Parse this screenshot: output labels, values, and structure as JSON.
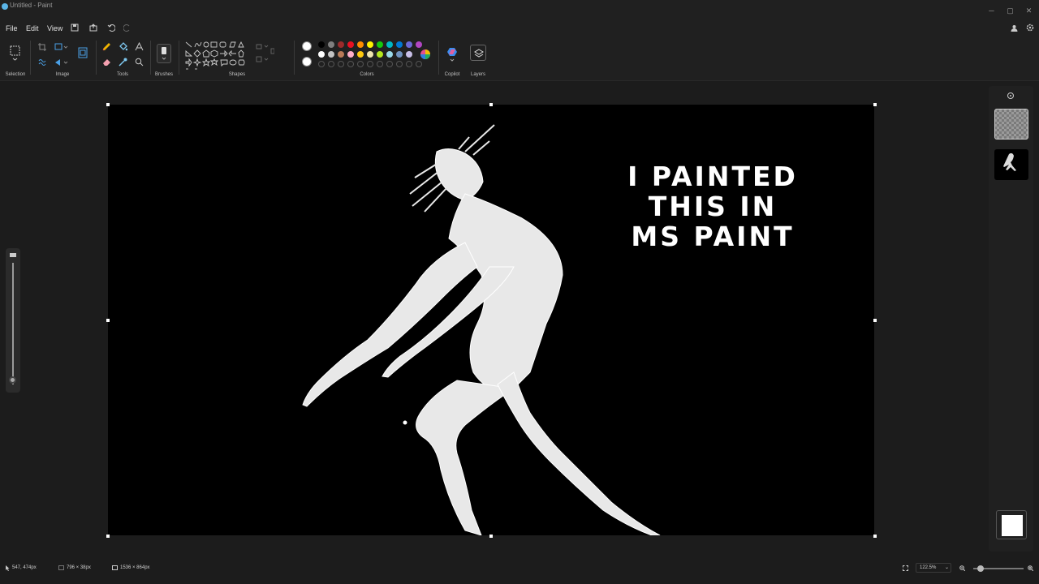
{
  "window": {
    "title": "Untitled - Paint",
    "minimize": "─",
    "maximize": "▢",
    "close": "✕"
  },
  "menu": {
    "file": "File",
    "edit": "Edit",
    "view": "View"
  },
  "ribbon": {
    "groups": {
      "selection": "Selection",
      "image": "Image",
      "tools": "Tools",
      "brushes": "Brushes",
      "shapes": "Shapes",
      "colors": "Colors",
      "copilot": "Copilot",
      "layers": "Layers"
    },
    "palette_row1": [
      "#000000",
      "#7f7f7f",
      "#9b2b2b",
      "#e81123",
      "#ff8c00",
      "#fff100",
      "#16c60c",
      "#00b7c3",
      "#0078d4",
      "#6b69d6",
      "#b146c2"
    ],
    "palette_row2": [
      "#ffffff",
      "#c3c3c3",
      "#b97a57",
      "#ffaec9",
      "#ffc90e",
      "#efe4b0",
      "#b5e61d",
      "#99d9ea",
      "#7092be",
      "#c8bfe7"
    ],
    "primary_color": "#ffffff",
    "secondary_color": "#ffffff"
  },
  "canvas": {
    "text_lines": "I PAINTED\nTHIS IN\nMS PAINT"
  },
  "status": {
    "cursor_position": "547, 474px",
    "selection_size": "796 × 38px",
    "canvas_size": "1536 × 864px",
    "zoom": "122.5%"
  }
}
